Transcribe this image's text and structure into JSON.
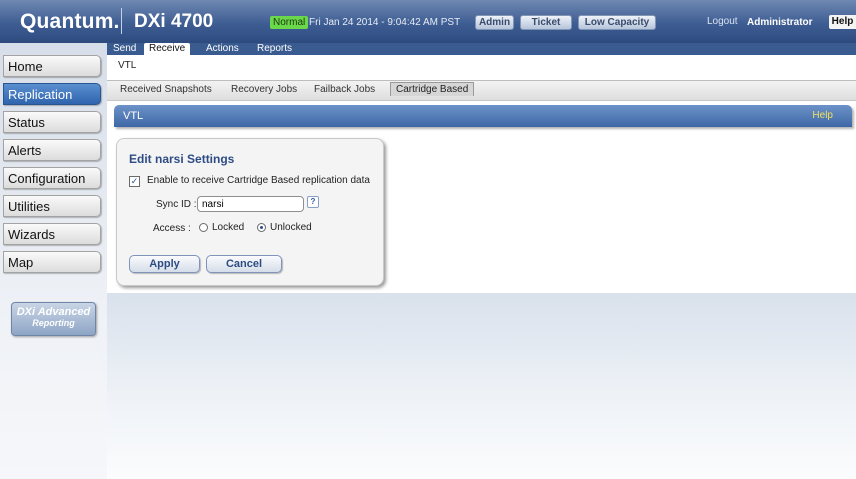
{
  "header": {
    "logo": "Quantum.",
    "product": "DXi 4700",
    "status": "Normal",
    "datetime": "Fri Jan 24 2014 - 9:04:42 AM PST",
    "buttons": [
      "Admin",
      "Ticket",
      "Low Capacity"
    ],
    "logout": "Logout",
    "user": "Administrator",
    "help": "Help"
  },
  "sidebar": {
    "items": [
      "Home",
      "Replication",
      "Status",
      "Alerts",
      "Configuration",
      "Utilities",
      "Wizards",
      "Map"
    ],
    "active": "Replication",
    "reporting_line1": "DXi Advanced",
    "reporting_line2": "Reporting"
  },
  "subtabs": [
    "Send",
    "Receive",
    "Actions",
    "Reports"
  ],
  "subtab_active": "Receive",
  "breadcrumb": "VTL",
  "tertiary_tabs": [
    "Received Snapshots",
    "Recovery Jobs",
    "Failback Jobs",
    "Cartridge Based"
  ],
  "tertiary_active": "Cartridge Based",
  "panel": {
    "title": "VTL",
    "help": "Help"
  },
  "card": {
    "title": "Edit narsi Settings",
    "checkbox_label": "Enable to receive Cartridge Based replication data",
    "checkbox_checked": true,
    "sync_label": "Sync ID :",
    "sync_value": "narsi",
    "help_mark": "?",
    "access_label": "Access :",
    "access_options": [
      "Locked",
      "Unlocked"
    ],
    "access_selected": "Unlocked",
    "apply": "Apply",
    "cancel": "Cancel"
  },
  "colors": {
    "header_blue": "#3e5d92",
    "status_green": "#6bd74a",
    "nav_active": "#2f64ae",
    "accent_text": "#2e4c84",
    "help_yellow": "#f0e060"
  }
}
